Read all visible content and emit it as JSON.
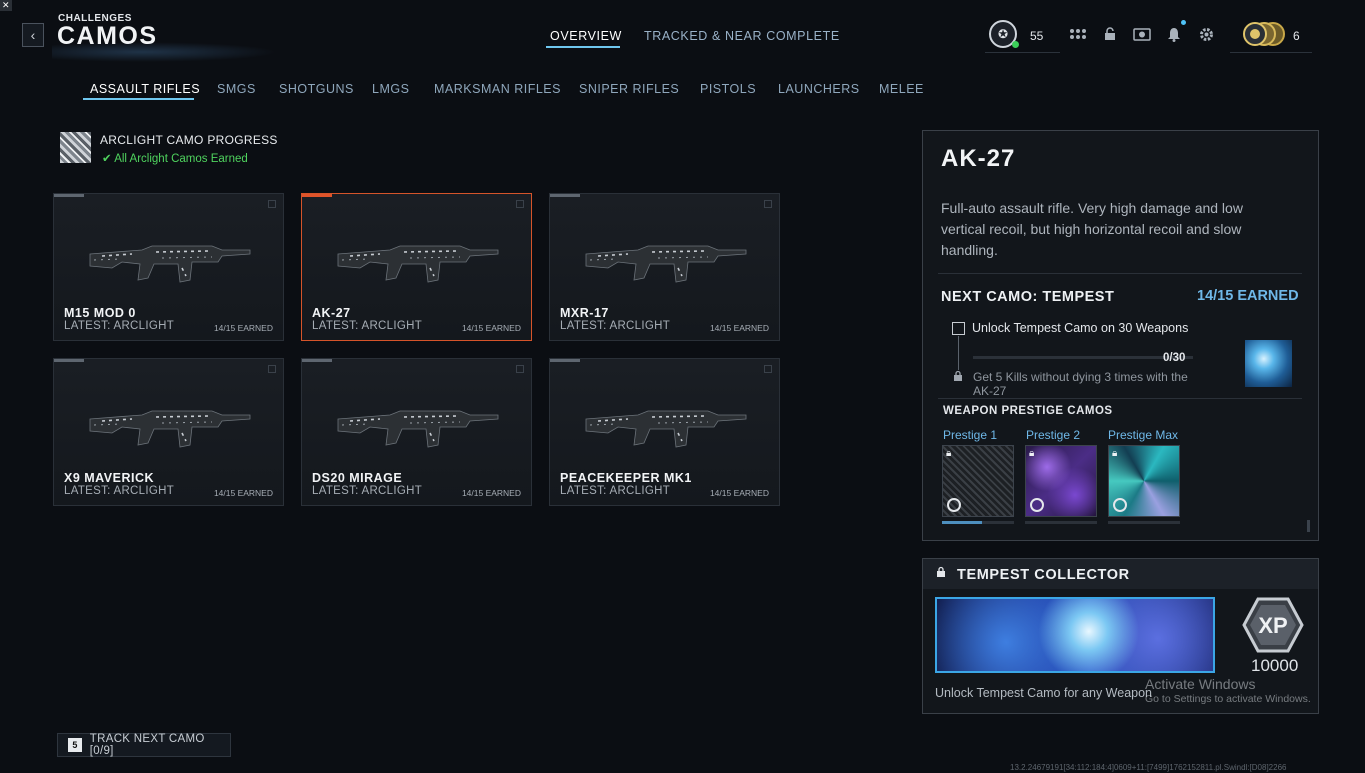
{
  "header": {
    "breadcrumb": "CHALLENGES",
    "title": "CAMOS",
    "tabs": [
      {
        "label": "OVERVIEW",
        "active": true
      },
      {
        "label": "TRACKED & NEAR COMPLETE",
        "active": false
      }
    ],
    "player_level": "55",
    "currency_count": "6"
  },
  "categories": [
    {
      "label": "ASSAULT RIFLES",
      "active": true
    },
    {
      "label": "SMGS"
    },
    {
      "label": "SHOTGUNS"
    },
    {
      "label": "LMGS"
    },
    {
      "label": "MARKSMAN RIFLES"
    },
    {
      "label": "SNIPER RIFLES"
    },
    {
      "label": "PISTOLS"
    },
    {
      "label": "LAUNCHERS"
    },
    {
      "label": "MELEE"
    }
  ],
  "arclight": {
    "title": "ARCLIGHT CAMO PROGRESS",
    "status": "✔ All Arclight Camos Earned"
  },
  "weapons": [
    {
      "name": "M15 MOD 0",
      "latest": "LATEST: ARCLIGHT",
      "earned": "14/15 EARNED",
      "selected": false
    },
    {
      "name": "AK-27",
      "latest": "LATEST: ARCLIGHT",
      "earned": "14/15 EARNED",
      "selected": true
    },
    {
      "name": "MXR-17",
      "latest": "LATEST: ARCLIGHT",
      "earned": "14/15 EARNED",
      "selected": false
    },
    {
      "name": "X9 MAVERICK",
      "latest": "LATEST: ARCLIGHT",
      "earned": "14/15 EARNED",
      "selected": false
    },
    {
      "name": "DS20 MIRAGE",
      "latest": "LATEST: ARCLIGHT",
      "earned": "14/15 EARNED",
      "selected": false
    },
    {
      "name": "PEACEKEEPER MK1",
      "latest": "LATEST: ARCLIGHT",
      "earned": "14/15 EARNED",
      "selected": false
    }
  ],
  "detail": {
    "weapon_name": "AK-27",
    "description": "Full-auto assault rifle. Very high damage and low vertical recoil, but high horizontal recoil and slow handling.",
    "next_camo_label": "NEXT CAMO: TEMPEST",
    "next_camo_earned": "14/15 EARNED",
    "challenge_title": "Unlock Tempest Camo on 30 Weapons",
    "challenge_progress": "0/30",
    "challenge_progress_fraction": 0,
    "challenge_desc": "Get 5 Kills without dying 3 times with the AK-27",
    "prestige_heading": "WEAPON PRESTIGE CAMOS",
    "prestige": [
      {
        "label": "Prestige 1",
        "progress": 0.55
      },
      {
        "label": "Prestige 2",
        "progress": 0
      },
      {
        "label": "Prestige Max",
        "progress": 0
      }
    ]
  },
  "collector": {
    "title": "TEMPEST COLLECTOR",
    "xp_badge": "XP",
    "xp_value": "10000",
    "description": "Unlock Tempest Camo for any Weapon"
  },
  "watermark": {
    "line1": "Activate Windows",
    "line2": "Go to Settings to activate Windows."
  },
  "footer": {
    "track_key": "5",
    "track_label": "TRACK NEXT CAMO [0/9]",
    "build": "13.2.24679191[34:112:184:4]0609+11:[7499]1762152811.pl.Swindl:[D08]2266"
  },
  "colors": {
    "accent": "#6fc7ef",
    "selected_border": "#d5542a",
    "success": "#4fd35e",
    "earned_blue": "#6fb8e8"
  },
  "icons": [
    "back-icon",
    "rank-icon",
    "grid-icon",
    "lock-icon",
    "camera-icon",
    "bell-icon",
    "gear-icon",
    "currency-icon"
  ]
}
